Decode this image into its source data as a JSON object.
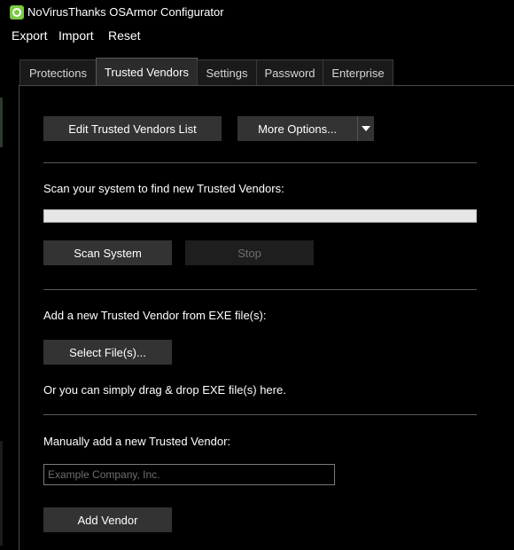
{
  "window": {
    "title": "NoVirusThanks OSArmor Configurator",
    "icon": "osarmor-gear-icon"
  },
  "menu": {
    "items": [
      "Export",
      "Import",
      "Reset"
    ]
  },
  "tabs": [
    {
      "label": "Protections",
      "active": false
    },
    {
      "label": "Trusted Vendors",
      "active": true
    },
    {
      "label": "Settings",
      "active": false
    },
    {
      "label": "Password",
      "active": false
    },
    {
      "label": "Enterprise",
      "active": false
    }
  ],
  "trusted_vendors": {
    "edit_list_button": "Edit Trusted Vendors List",
    "more_options_button": "More Options...",
    "scan_label": "Scan your system to find new Trusted Vendors:",
    "scan_progress": 0,
    "scan_button": "Scan System",
    "stop_button": "Stop",
    "add_from_exe_label": "Add a new Trusted Vendor from EXE file(s):",
    "select_files_button": "Select File(s)...",
    "drag_drop_label": "Or you can simply drag & drop EXE file(s) here.",
    "manual_add_label": "Manually add a new Trusted Vendor:",
    "vendor_input": {
      "value": "",
      "placeholder": "Example Company, Inc."
    },
    "add_vendor_button": "Add Vendor"
  },
  "colors": {
    "background": "#000000",
    "button": "#333333",
    "button_disabled": "#1e1e1e",
    "icon_green": "#7ac943"
  }
}
